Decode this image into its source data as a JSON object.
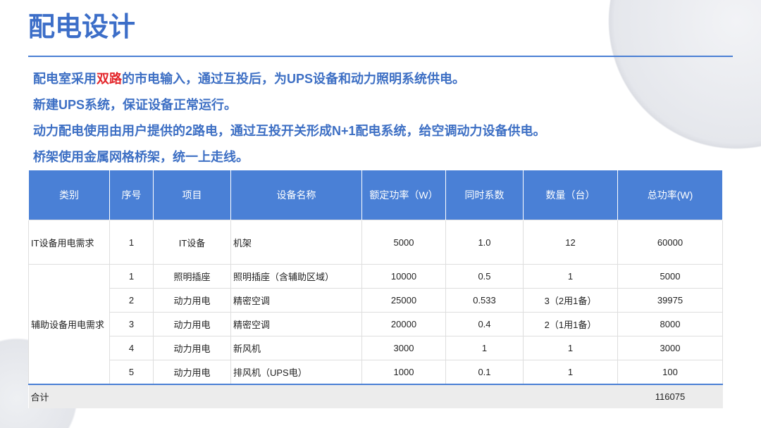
{
  "slide": {
    "title": "配电设计",
    "bullets": [
      {
        "before": "配电室采用",
        "highlight": "双路",
        "after": "的市电输入，通过互投后，为UPS设备和动力照明系统供电。"
      },
      {
        "text": "新建UPS系统，保证设备正常运行。"
      },
      {
        "text": "动力配电使用由用户提供的2路电，通过互投开关形成N+1配电系统，给空调动力设备供电。"
      },
      {
        "text": "桥架使用金属网格桥架，统一上走线。"
      }
    ]
  },
  "table": {
    "headers": [
      "类别",
      "序号",
      "项目",
      "设备名称",
      "额定功率（W）",
      "同时系数",
      "数量（台）",
      "总功率(W)"
    ],
    "groups": [
      {
        "category": "IT设备用电需求",
        "rows": [
          {
            "no": "1",
            "item": "IT设备",
            "device": "机架",
            "rated_power": "5000",
            "factor": "1.0",
            "quantity": "12",
            "total_power": "60000"
          }
        ]
      },
      {
        "category": "辅助设备用电需求",
        "rows": [
          {
            "no": "1",
            "item": "照明插座",
            "device": "照明插座（含辅助区域）",
            "rated_power": "10000",
            "factor": "0.5",
            "quantity": "1",
            "total_power": "5000"
          },
          {
            "no": "2",
            "item": "动力用电",
            "device": "精密空调",
            "rated_power": "25000",
            "factor": "0.533",
            "quantity": "3（2用1备）",
            "total_power": "39975"
          },
          {
            "no": "3",
            "item": "动力用电",
            "device": "精密空调",
            "rated_power": "20000",
            "factor": "0.4",
            "quantity": "2（1用1备）",
            "total_power": "8000"
          },
          {
            "no": "4",
            "item": "动力用电",
            "device": "新风机",
            "rated_power": "3000",
            "factor": "1",
            "quantity": "1",
            "total_power": "3000"
          },
          {
            "no": "5",
            "item": "动力用电",
            "device": "排风机（UPS电）",
            "rated_power": "1000",
            "factor": "0.1",
            "quantity": "1",
            "total_power": "100"
          }
        ]
      }
    ],
    "total": {
      "label": "合计",
      "value": "116075"
    }
  },
  "colors": {
    "accent": "#3c6ec8",
    "header_bg": "#4a80d6",
    "highlight": "#e3262b",
    "total_bg": "#ececec"
  }
}
